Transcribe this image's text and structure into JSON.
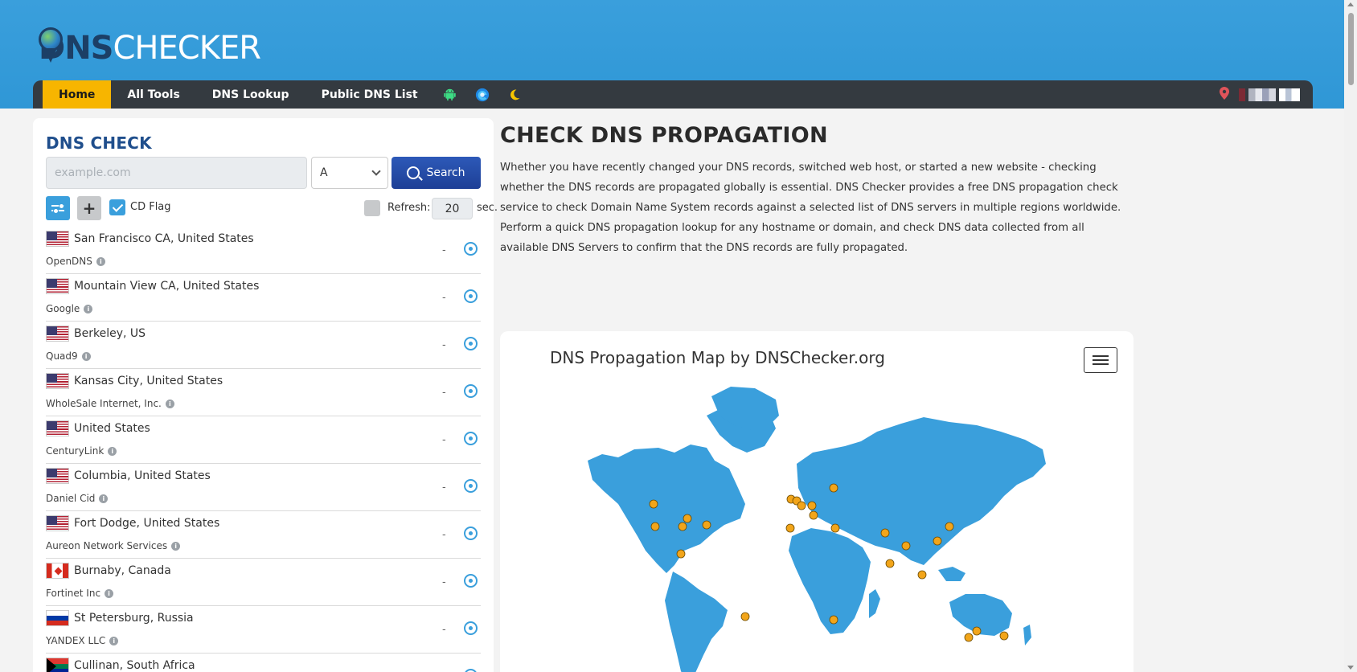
{
  "logo": {
    "part1": "DNS",
    "part2": "CHECKER"
  },
  "nav": {
    "items": [
      {
        "label": "Home",
        "active": true
      },
      {
        "label": "All Tools"
      },
      {
        "label": "DNS Lookup"
      },
      {
        "label": "Public DNS List"
      }
    ],
    "icons": [
      "android-icon",
      "edge-icon",
      "moon-icon"
    ],
    "right_icons": [
      "location-pin-icon",
      "flag-icon"
    ]
  },
  "dns_check": {
    "title": "DNS CHECK",
    "input_placeholder": "example.com",
    "record_type": "A",
    "search_label": "Search",
    "cd_flag_label": "CD Flag",
    "refresh_label": "Refresh:",
    "refresh_value": "20",
    "sec_label": "sec."
  },
  "servers": [
    {
      "flag": "us",
      "location": "San Francisco CA, United States",
      "provider": "OpenDNS",
      "result": "-"
    },
    {
      "flag": "us",
      "location": "Mountain View CA, United States",
      "provider": "Google",
      "result": "-"
    },
    {
      "flag": "us",
      "location": "Berkeley, US",
      "provider": "Quad9",
      "result": "-"
    },
    {
      "flag": "us",
      "location": "Kansas City, United States",
      "provider": "WholeSale Internet, Inc.",
      "result": "-"
    },
    {
      "flag": "us",
      "location": "United States",
      "provider": "CenturyLink",
      "result": "-"
    },
    {
      "flag": "us",
      "location": "Columbia, United States",
      "provider": "Daniel Cid",
      "result": "-"
    },
    {
      "flag": "us",
      "location": "Fort Dodge, United States",
      "provider": "Aureon Network Services",
      "result": "-"
    },
    {
      "flag": "ca",
      "location": "Burnaby, Canada",
      "provider": "Fortinet Inc",
      "result": "-"
    },
    {
      "flag": "ru",
      "location": "St Petersburg, Russia",
      "provider": "YANDEX LLC",
      "result": "-"
    },
    {
      "flag": "za",
      "location": "Cullinan, South Africa",
      "provider": "",
      "result": "-"
    }
  ],
  "main": {
    "title": "CHECK DNS PROPAGATION",
    "intro": "Whether you have recently changed your DNS records, switched web host, or started a new website - checking whether the DNS records are propagated globally is essential. DNS Checker provides a free DNS propagation check service to check Domain Name System records against a selected list of DNS servers in multiple regions worldwide. Perform a quick DNS propagation lookup for any hostname or domain, and check DNS data collected from all available DNS Servers to confirm that the DNS records are fully propagated."
  },
  "map": {
    "title": "DNS Propagation Map by DNSChecker.org",
    "land_color": "#3a9fdc",
    "marker_color": "#f2a51a"
  },
  "colors": {
    "header": "#3a9fdc",
    "navbar": "#343a40",
    "active_nav": "#f7b500",
    "search_button": "#2d59b8",
    "title_blue": "#1f4e8c"
  }
}
